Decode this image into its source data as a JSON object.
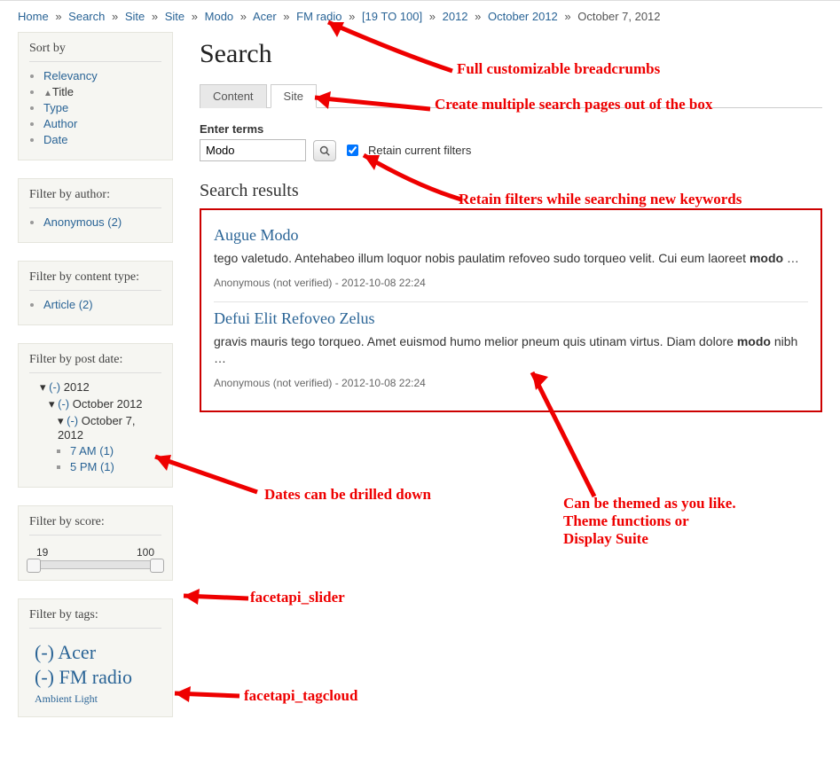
{
  "breadcrumbs": {
    "items": [
      "Home",
      "Search",
      "Site",
      "Site",
      "Modo",
      "Acer",
      "FM radio",
      "[19 TO 100]",
      "2012",
      "October 2012"
    ],
    "current": "October 7, 2012",
    "separator": "»"
  },
  "sidebar": {
    "sort": {
      "title": "Sort by",
      "items": [
        "Relevancy",
        "Title",
        "Type",
        "Author",
        "Date"
      ],
      "active_index": 1
    },
    "author": {
      "title": "Filter by author:",
      "items": [
        "Anonymous (2)"
      ]
    },
    "content_type": {
      "title": "Filter by content type:",
      "items": [
        "Article (2)"
      ]
    },
    "post_date": {
      "title": "Filter by post date:",
      "l1_prefix": "(-)",
      "l1": "2012",
      "l2_prefix": "(-)",
      "l2": "October 2012",
      "l3_prefix": "(-)",
      "l3": "October 7, 2012",
      "leaf1": "7 AM (1)",
      "leaf2": "5 PM (1)"
    },
    "score": {
      "title": "Filter by score:",
      "min": "19",
      "max": "100"
    },
    "tags": {
      "title": "Filter by tags:",
      "t1_prefix": "(-)",
      "t1": "Acer",
      "t2_prefix": "(-)",
      "t2": "FM radio",
      "t3": "Ambient Light"
    }
  },
  "main": {
    "title": "Search",
    "tabs": {
      "content": "Content",
      "site": "Site"
    },
    "search": {
      "label": "Enter terms",
      "value": "Modo",
      "retain_label": "Retain current filters",
      "retain_checked": true
    },
    "results_title": "Search results",
    "results": [
      {
        "title": "Augue Modo",
        "snippet_pre": "tego valetudo. Antehabeo illum loquor nobis paulatim refoveo sudo torqueo velit. Cui eum laoreet ",
        "snippet_bold": "modo",
        "snippet_post": " …",
        "meta": "Anonymous (not verified) - 2012-10-08 22:24"
      },
      {
        "title": "Defui Elit Refoveo Zelus",
        "snippet_pre": "gravis mauris tego torqueo. Amet euismod humo melior pneum quis utinam virtus. Diam dolore ",
        "snippet_bold": "modo",
        "snippet_post": " nibh …",
        "meta": "Anonymous (not verified) - 2012-10-08 22:24"
      }
    ]
  },
  "annotations": {
    "breadcrumbs": "Full customizable breadcrumbs",
    "tabs": "Create multiple search pages out of the box",
    "retain": "Retain filters while searching new keywords",
    "dates": "Dates can be drilled down",
    "theme": "Can be themed as you like.\nTheme functions or\nDisplay Suite",
    "slider": "facetapi_slider",
    "tagcloud": "facetapi_tagcloud"
  }
}
